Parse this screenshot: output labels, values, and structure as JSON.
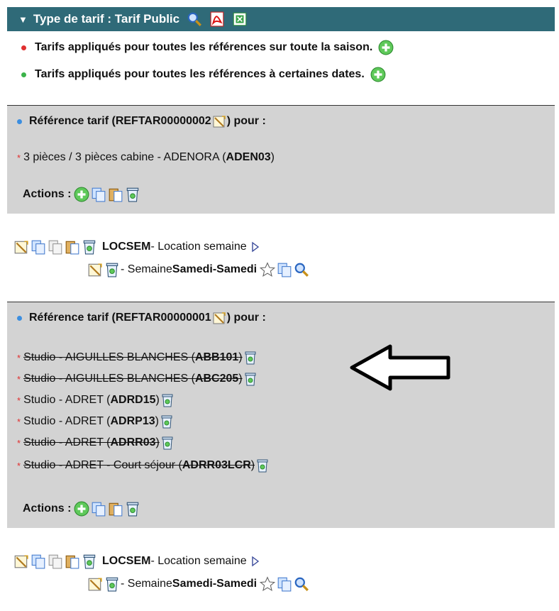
{
  "header": {
    "title": "Type de tarif : Tarif Public"
  },
  "legend": {
    "season_text": "Tarifs appliqués pour toutes les références sur toute la saison.",
    "dates_text": "Tarifs appliqués pour toutes les références à certaines dates."
  },
  "refs": [
    {
      "title_prefix": "Référence tarif (REFTAR00000002",
      "title_suffix": ") pour :",
      "items": [
        {
          "prefix": "3 pièces / 3 pièces cabine - ADENORA (",
          "code": "ADEN03",
          "suffix": ")"
        }
      ],
      "actions_label": "Actions :"
    },
    {
      "title_prefix": "Référence tarif (REFTAR00000001",
      "title_suffix": ") pour :",
      "items": [
        {
          "prefix": "Studio - AIGUILLES BLANCHES (",
          "code": "ABB101",
          "suffix": ")"
        },
        {
          "prefix": "Studio - AIGUILLES BLANCHES (",
          "code": "ABC205",
          "suffix": ")"
        },
        {
          "prefix": "Studio - ADRET (",
          "code": "ADRD15",
          "suffix": ")"
        },
        {
          "prefix": "Studio - ADRET (",
          "code": "ADRP13",
          "suffix": ")"
        },
        {
          "prefix": "Studio - ADRET (",
          "code": "ADRR03",
          "suffix": ")"
        },
        {
          "prefix": "Studio - ADRET - Court séjour (",
          "code": "ADRR03LCR",
          "suffix": ")"
        }
      ],
      "actions_label": "Actions :"
    }
  ],
  "tariff_rows": [
    {
      "code": "LOCSEM",
      "label": " - Location semaine",
      "sub_prefix": " - Semaine ",
      "sub_bold": "Samedi-Samedi"
    },
    {
      "code": "LOCSEM",
      "label": " - Location semaine",
      "sub_prefix": " - Semaine ",
      "sub_bold": "Samedi-Samedi"
    }
  ],
  "colors": {
    "header_bg": "#2f6a78",
    "panel_bg": "#d3d3d3",
    "legend_red": "#e03030",
    "legend_green": "#3bb34a"
  }
}
